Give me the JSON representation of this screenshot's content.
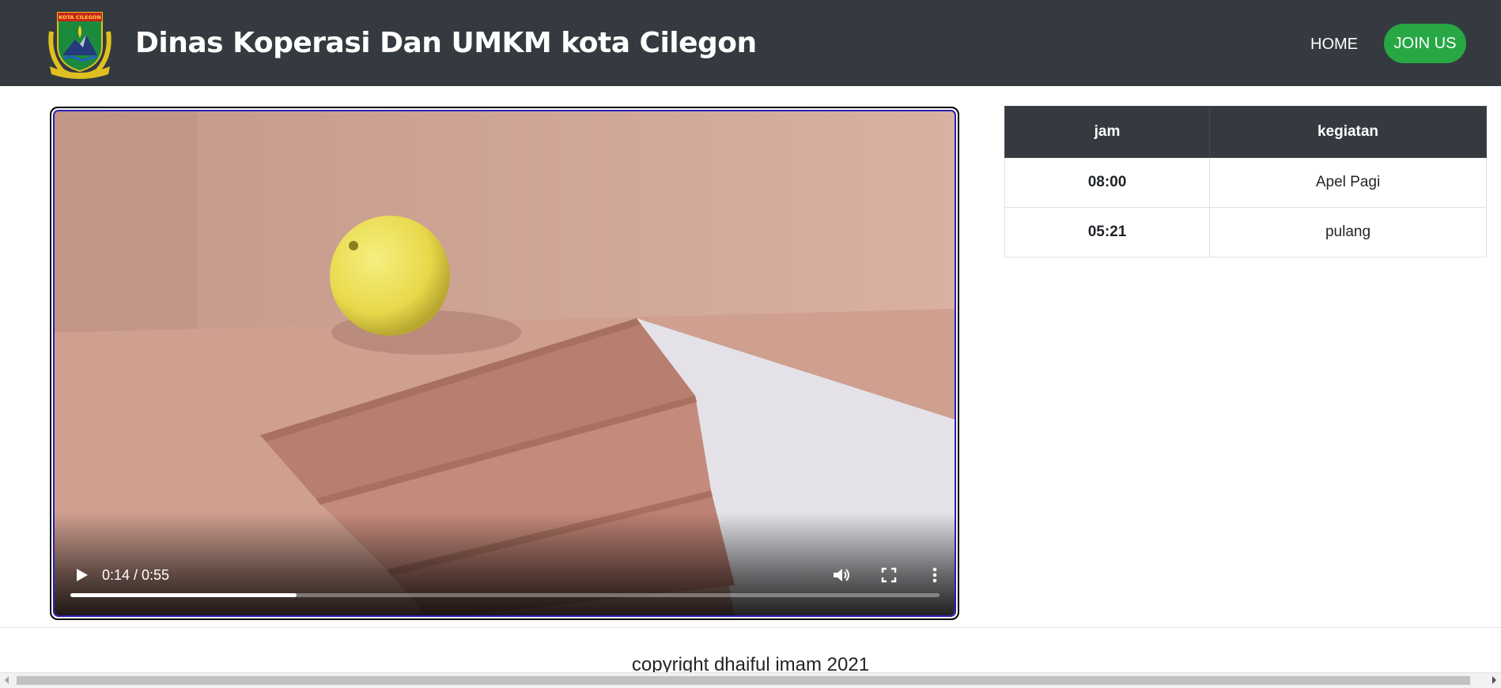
{
  "navbar": {
    "logo_text": "KOTA CILEGON",
    "brand": "Dinas Koperasi Dan UMKM kota Cilegon",
    "home_label": "HOME",
    "join_label": "JOIN US"
  },
  "video": {
    "current_time": "0:14",
    "duration": "0:55",
    "time_display": "0:14 / 0:55",
    "progress_fraction": 0.26,
    "icons": [
      "play-icon",
      "volume-icon",
      "fullscreen-icon",
      "more-options-icon"
    ]
  },
  "schedule": {
    "headers": [
      "jam",
      "kegiatan"
    ],
    "rows": [
      {
        "time": "08:00",
        "activity": "Apel Pagi"
      },
      {
        "time": "05:21",
        "activity": "pulang"
      }
    ]
  },
  "footer": {
    "copyright": "copyright dhaiful imam 2021"
  },
  "colors": {
    "navbar_bg": "#343a40",
    "join_button": "#28a745",
    "table_header_bg": "#343a40",
    "video_border": "#2a1fb8"
  }
}
